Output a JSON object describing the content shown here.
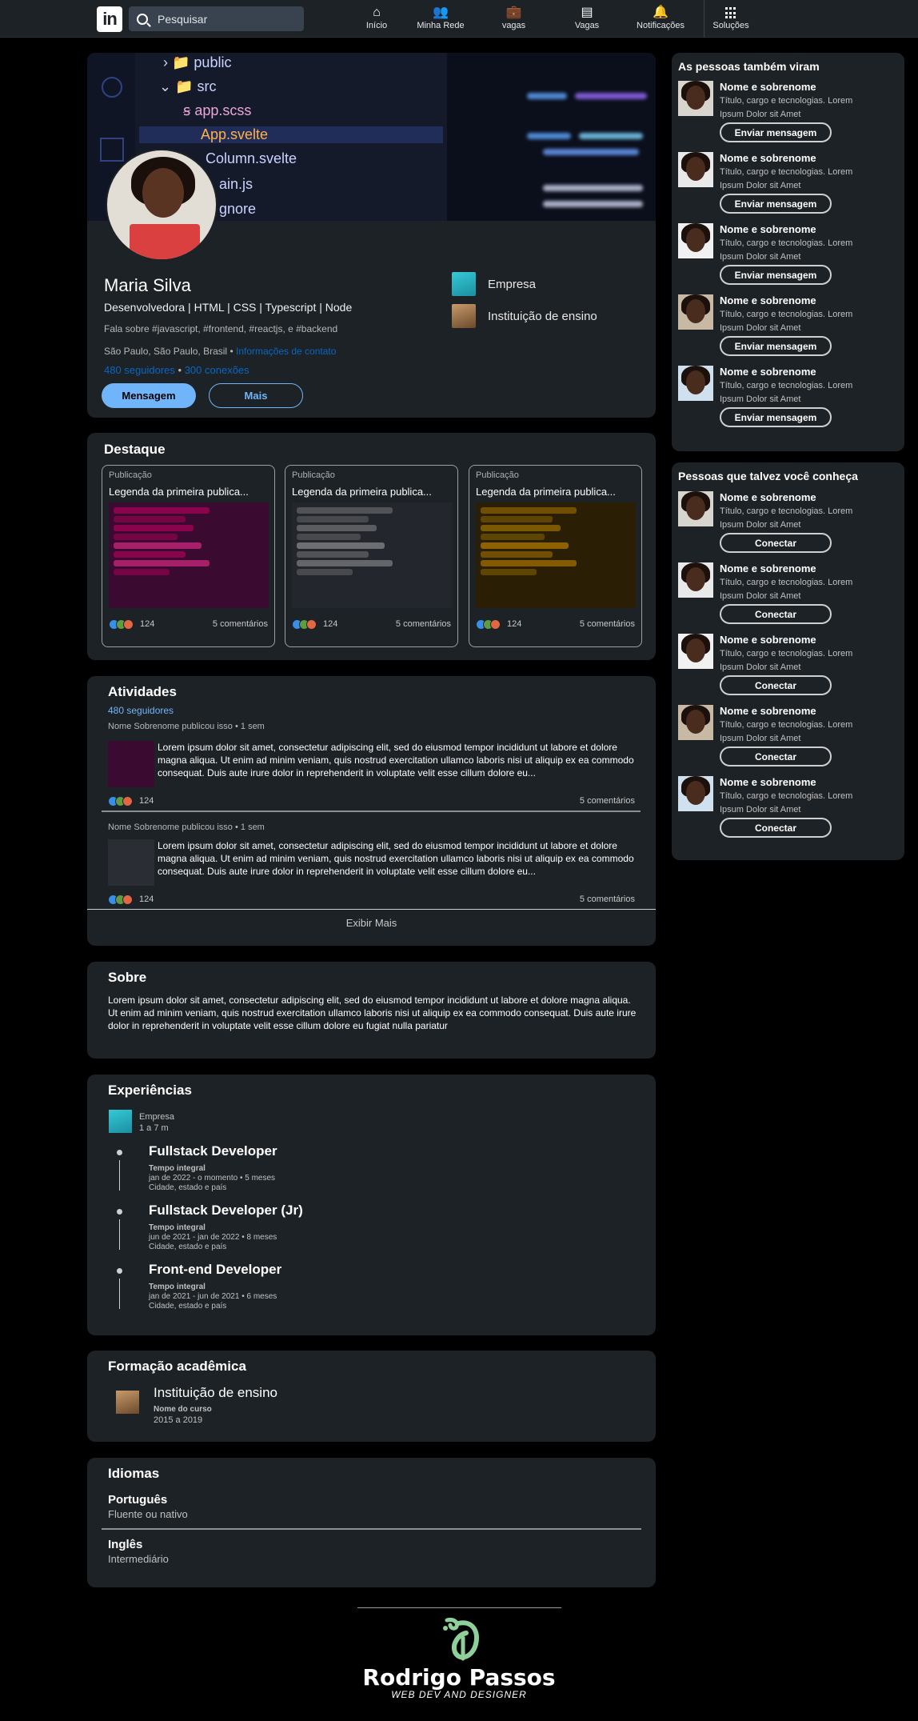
{
  "nav": {
    "logo": "in",
    "search_placeholder": "Pesquisar",
    "items": [
      {
        "label": "Início",
        "icon": "home-icon"
      },
      {
        "label": "Minha Rede",
        "icon": "network-icon"
      },
      {
        "label": "vagas",
        "icon": "briefcase-icon"
      },
      {
        "label": "Vagas",
        "icon": "message-icon"
      },
      {
        "label": "Notificações",
        "icon": "bell-icon"
      },
      {
        "label": "Soluções",
        "icon": "grid-icon"
      }
    ]
  },
  "cover": {
    "files": [
      "public",
      "src",
      "app.scss",
      "App.svelte",
      "Column.svelte",
      "ain.js",
      "gnore"
    ]
  },
  "profile": {
    "name": "Maria Silva",
    "headline": "Desenvolvedora | HTML | CSS | Typescript | Node",
    "about_tags": "Fala sobre #javascript, #frontend, #reactjs, e #backend",
    "location": "São Paulo, São Paulo, Brasil",
    "contact_link": "Informações de contato",
    "followers_link": "480 seguidores",
    "connections_link": "300 conexões",
    "message_button": "Mensagem",
    "more_button": "Mais",
    "company": "Empresa",
    "school": "Instituição de ensino"
  },
  "highlights": {
    "title": "Destaque",
    "posts": [
      {
        "label": "Publicação",
        "caption": "Legenda da primeira publica...",
        "reactions": "124",
        "comments": "5 comentários"
      },
      {
        "label": "Publicação",
        "caption": "Legenda da primeira publica...",
        "reactions": "124",
        "comments": "5 comentários"
      },
      {
        "label": "Publicação",
        "caption": "Legenda da primeira publica...",
        "reactions": "124",
        "comments": "5 comentários"
      }
    ]
  },
  "activity": {
    "title": "Atividades",
    "followers": "480 seguidores",
    "posts": [
      {
        "meta": "Nome Sobrenome publicou isso",
        "time": "1 sem",
        "text": "Lorem ipsum dolor sit amet, consectetur adipiscing elit, sed do eiusmod tempor incididunt ut labore et dolore magna aliqua. Ut enim ad minim veniam, quis nostrud exercitation ullamco laboris nisi ut aliquip ex ea commodo consequat. Duis aute irure dolor in reprehenderit in voluptate velit esse cillum dolore eu...",
        "reactions": "124",
        "comments": "5 comentários"
      },
      {
        "meta": "Nome Sobrenome publicou isso",
        "time": "1 sem",
        "text": "Lorem ipsum dolor sit amet, consectetur adipiscing elit, sed do eiusmod tempor incididunt ut labore et dolore magna aliqua. Ut enim ad minim veniam, quis nostrud exercitation ullamco laboris nisi ut aliquip ex ea commodo consequat. Duis aute irure dolor in reprehenderit in voluptate velit esse cillum dolore eu...",
        "reactions": "124",
        "comments": "5 comentários"
      }
    ],
    "show_more": "Exibir Mais"
  },
  "about": {
    "title": "Sobre",
    "text": "Lorem ipsum dolor sit amet, consectetur adipiscing elit, sed do eiusmod tempor incididunt ut labore et dolore magna aliqua. Ut enim ad minim veniam, quis nostrud exercitation ullamco laboris nisi ut aliquip ex ea commodo consequat. Duis aute irure dolor in reprehenderit in voluptate velit esse cillum dolore eu fugiat nulla pariatur"
  },
  "experience": {
    "title": "Experiências",
    "company": "Empresa",
    "duration": "1 a 7 m",
    "roles": [
      {
        "title": "Fullstack Developer",
        "type": "Tempo integral",
        "period": "jan de 2022 - o momento • 5 meses",
        "place": "Cidade, estado e país"
      },
      {
        "title": "Fullstack Developer (Jr)",
        "type": "Tempo integral",
        "period": "jun de 2021 - jan de 2022 • 8 meses",
        "place": "Cidade, estado e país"
      },
      {
        "title": "Front-end Developer",
        "type": "Tempo integral",
        "period": "jan de 2021 - jun de 2021 • 6 meses",
        "place": "Cidade, estado e país"
      }
    ]
  },
  "education": {
    "title": "Formação acadêmica",
    "school": "Instituição de ensino",
    "course": "Nome do curso",
    "years": "2015 a 2019"
  },
  "languages": {
    "title": "Idiomas",
    "items": [
      {
        "name": "Português",
        "level": "Fluente ou nativo"
      },
      {
        "name": "Inglês",
        "level": "Intermediário"
      }
    ]
  },
  "also_viewed": {
    "title": "As pessoas também viram",
    "people": [
      {
        "name": "Nome e sobrenome",
        "desc": "Título, cargo e tecnologias. Lorem Ipsum Dolor sit Amet",
        "button": "Enviar mensagem"
      },
      {
        "name": "Nome e sobrenome",
        "desc": "Título, cargo e tecnologias. Lorem Ipsum Dolor sit Amet",
        "button": "Enviar mensagem"
      },
      {
        "name": "Nome e sobrenome",
        "desc": "Título, cargo e tecnologias. Lorem Ipsum Dolor sit Amet",
        "button": "Enviar mensagem"
      },
      {
        "name": "Nome e sobrenome",
        "desc": "Título, cargo e tecnologias. Lorem Ipsum Dolor sit Amet",
        "button": "Enviar mensagem"
      },
      {
        "name": "Nome e sobrenome",
        "desc": "Título, cargo e tecnologias. Lorem Ipsum Dolor sit Amet",
        "button": "Enviar mensagem"
      }
    ]
  },
  "may_know": {
    "title": "Pessoas que talvez você conheça",
    "people": [
      {
        "name": "Nome e sobrenome",
        "desc": "Título, cargo e tecnologias. Lorem Ipsum Dolor sit Amet",
        "button": "Conectar"
      },
      {
        "name": "Nome e sobrenome",
        "desc": "Título, cargo e tecnologias. Lorem Ipsum Dolor sit Amet",
        "button": "Conectar"
      },
      {
        "name": "Nome e sobrenome",
        "desc": "Título, cargo e tecnologias. Lorem Ipsum Dolor sit Amet",
        "button": "Conectar"
      },
      {
        "name": "Nome e sobrenome",
        "desc": "Título, cargo e tecnologias. Lorem Ipsum Dolor sit Amet",
        "button": "Conectar"
      },
      {
        "name": "Nome e sobrenome",
        "desc": "Título, cargo e tecnologias. Lorem Ipsum Dolor sit Amet",
        "button": "Conectar"
      }
    ]
  },
  "footer": {
    "name": "Rodrigo Passos",
    "tagline": "WEB DEV AND DESIGNER"
  },
  "colors": {
    "accent": "#70b5f9",
    "link": "#0a66c2",
    "card": "#1d2226",
    "page": "#000000",
    "logo_green": "#8fcf9a"
  }
}
